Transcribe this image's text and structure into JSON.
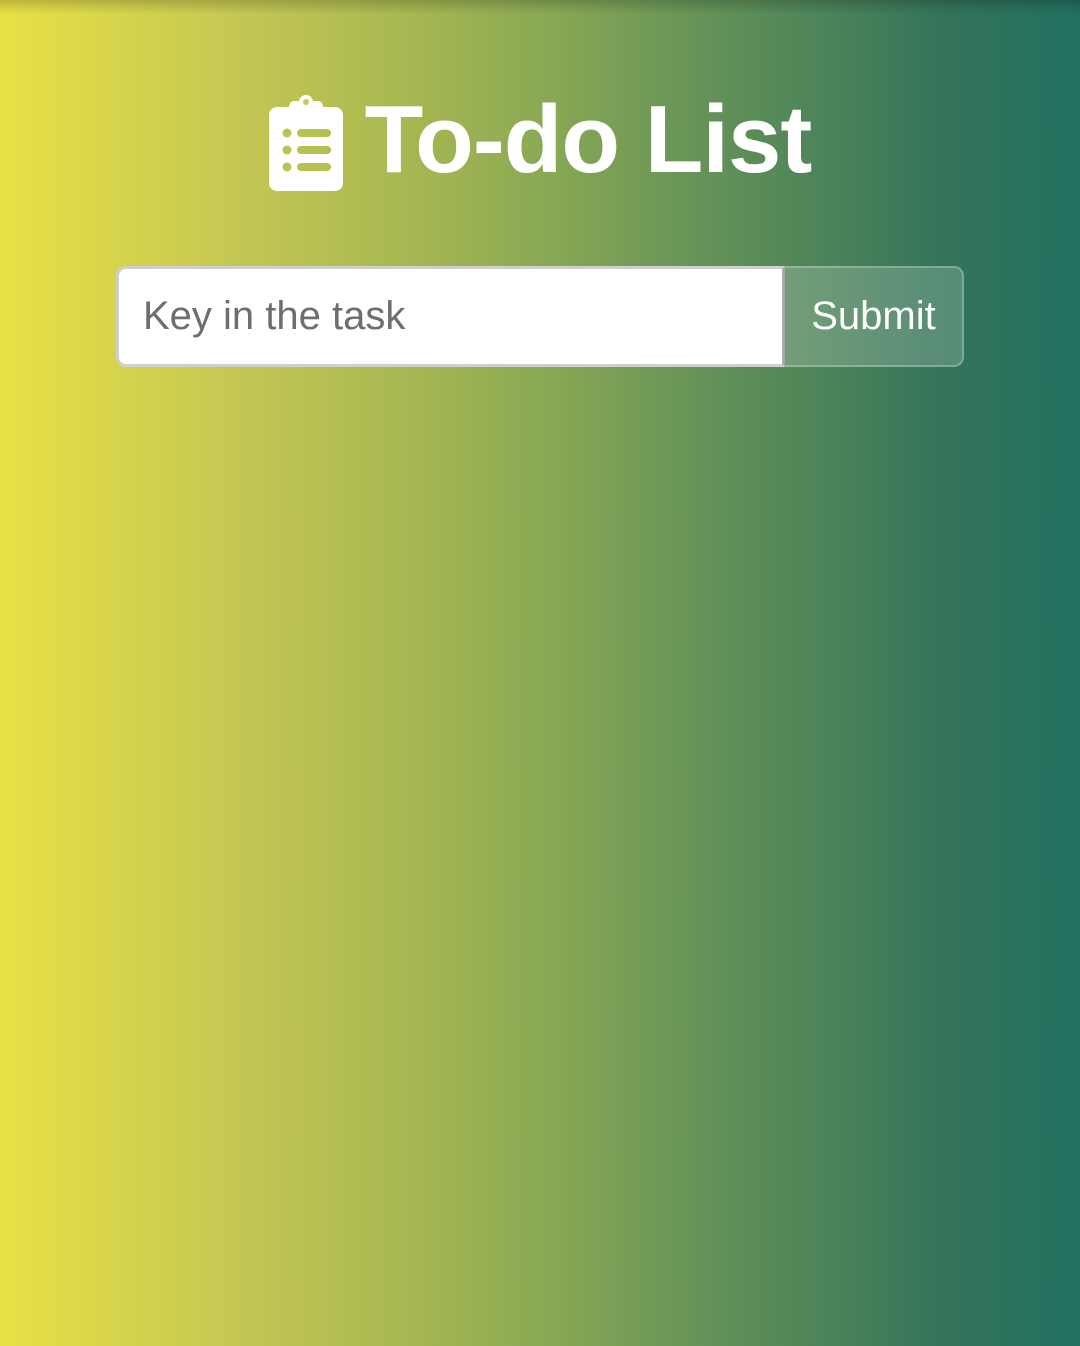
{
  "header": {
    "icon": "clipboard-list-icon",
    "title": "To-do List"
  },
  "form": {
    "input_value": "",
    "input_placeholder": "Key in the task",
    "submit_label": "Submit"
  },
  "colors": {
    "gradient_left": "#e8e145",
    "gradient_right": "#21705f",
    "text": "#ffffff",
    "input_background": "#ffffff",
    "placeholder": "#6e6e6e"
  }
}
